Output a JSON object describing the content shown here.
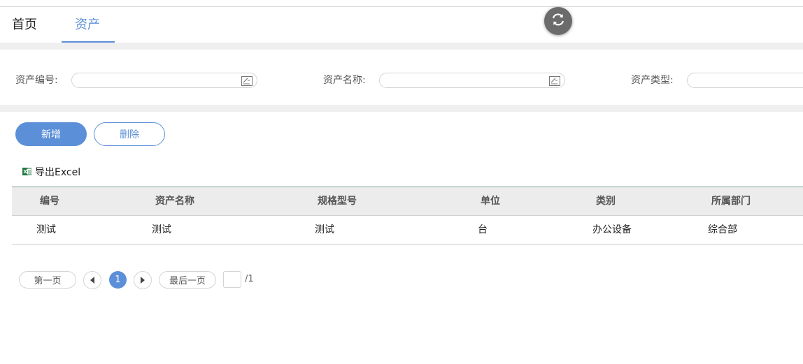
{
  "tabs": [
    {
      "label": "首页"
    },
    {
      "label": "资产"
    }
  ],
  "search": {
    "fields": [
      {
        "label": "资产编号:",
        "value": ""
      },
      {
        "label": "资产名称:",
        "value": ""
      },
      {
        "label": "资产类型:",
        "value": ""
      }
    ]
  },
  "toolbar": {
    "add_label": "新增",
    "delete_label": "删除",
    "export_label": "导出Excel"
  },
  "table": {
    "columns": [
      "编号",
      "资产名称",
      "规格型号",
      "单位",
      "类别",
      "所属部门"
    ],
    "rows": [
      [
        "测试",
        "测试",
        "测试",
        "台",
        "办公设备",
        "综合部"
      ]
    ]
  },
  "pagination": {
    "first_label": "第一页",
    "last_label": "最后一页",
    "current_page": "1",
    "page_input": "",
    "total": "/1"
  },
  "colors": {
    "accent": "#5b8fd8",
    "band": "#efefef",
    "header_bg": "#ececec"
  },
  "icons": {
    "refresh": "refresh-icon",
    "edit": "edit-icon",
    "excel": "excel-icon",
    "prev": "triangle-left-icon",
    "next": "triangle-right-icon"
  }
}
